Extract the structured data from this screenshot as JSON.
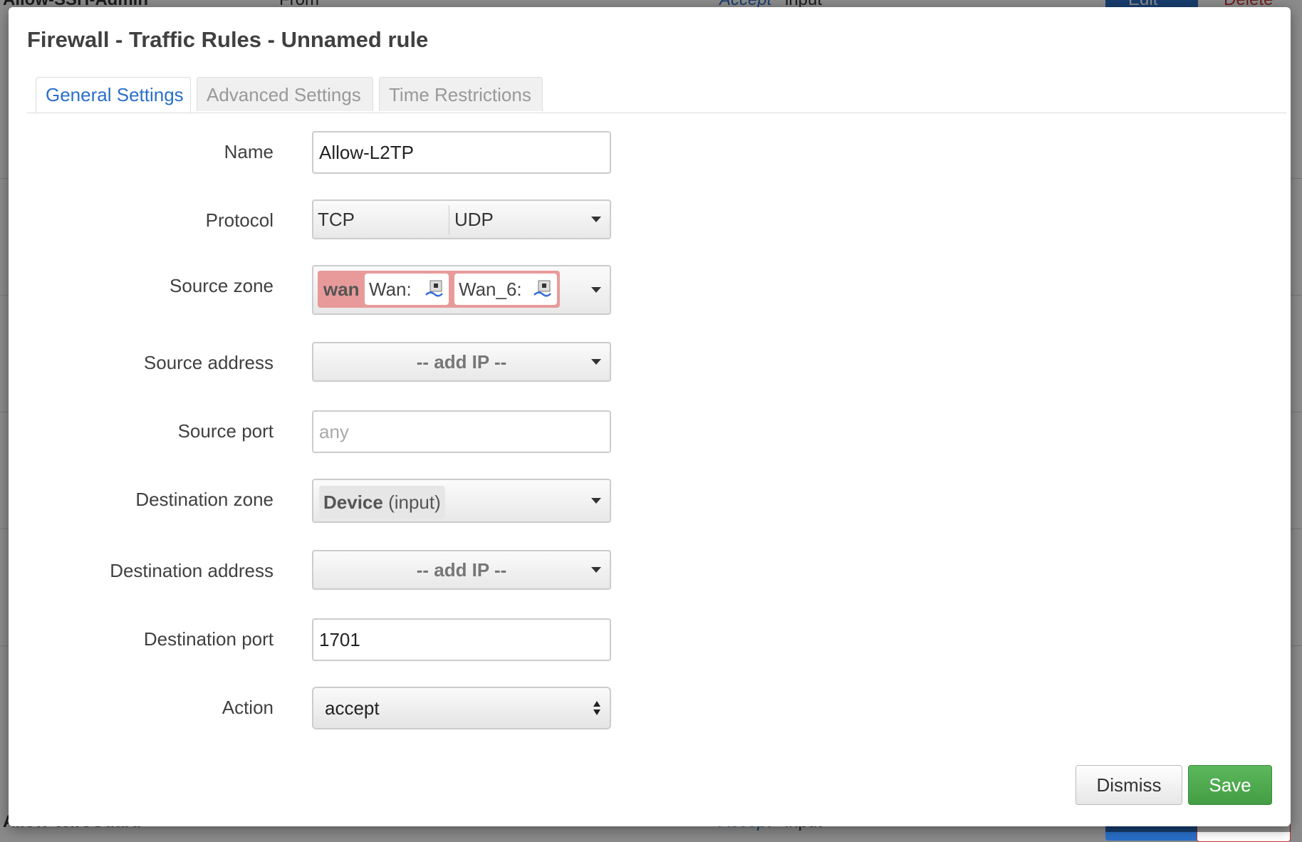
{
  "modal": {
    "title": "Firewall - Traffic Rules - Unnamed rule",
    "tabs": [
      "General Settings",
      "Advanced Settings",
      "Time Restrictions"
    ],
    "active_tab": "General Settings"
  },
  "form": {
    "name": {
      "label": "Name",
      "value": "Allow-L2TP"
    },
    "protocol": {
      "label": "Protocol",
      "values": [
        "TCP",
        "UDP"
      ]
    },
    "source_zone": {
      "label": "Source zone",
      "zone": "wan",
      "interfaces": [
        "Wan:",
        "Wan_6:"
      ],
      "zone_color": "#e89a9a"
    },
    "source_address": {
      "label": "Source address",
      "value": "-- add IP --"
    },
    "source_port": {
      "label": "Source port",
      "placeholder": "any"
    },
    "destination_zone": {
      "label": "Destination zone",
      "zone": "Device",
      "suffix": "(input)"
    },
    "destination_address": {
      "label": "Destination address",
      "value": "-- add IP --"
    },
    "destination_port": {
      "label": "Destination port",
      "value": "1701"
    },
    "action": {
      "label": "Action",
      "value": "accept"
    }
  },
  "buttons": {
    "dismiss": "Dismiss",
    "save": "Save"
  },
  "background": {
    "rows": [
      "Allow-SSH-Admin",
      "Allow-WireGuard"
    ],
    "actions": [
      "Accept",
      "input"
    ],
    "edit": "Edit",
    "delete": "Delete",
    "from": "From"
  },
  "colors": {
    "accent": "#2a6fc9",
    "save": "#4cae4c",
    "wan_zone": "#e89a9a"
  }
}
